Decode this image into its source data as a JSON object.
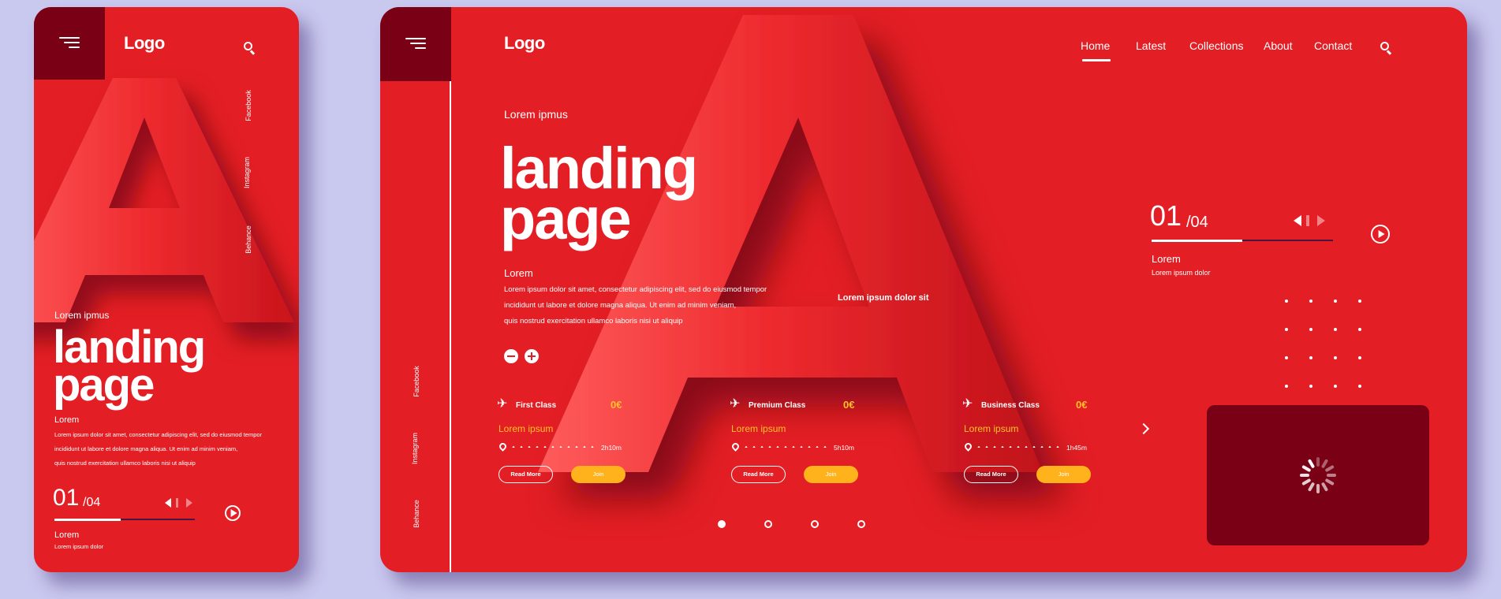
{
  "mobile": {
    "logo": "Logo",
    "social": [
      "Facebook",
      "Instagram",
      "Behance"
    ],
    "hero_eyebrow": "Lorem  ipmus",
    "hero_line1": "landing",
    "hero_line2": "page",
    "body_title": "Lorem",
    "body_lines": [
      "Lorem ipsum dolor sit amet, consectetur adipiscing elit, sed do eiusmod tempor",
      "incididunt ut labore et dolore magna aliqua. Ut enim ad minim veniam,",
      "quis nostrud exercitation ullamco laboris nisi ut aliquip"
    ],
    "counter_current": "01",
    "counter_total": "/04",
    "progress": 0.47,
    "slide_title": "Lorem",
    "slide_sub": "Lorem ipsum dolor"
  },
  "desktop": {
    "logo": "Logo",
    "nav": [
      "Home",
      "Latest",
      "Collections",
      "About",
      "Contact"
    ],
    "active_nav": "Home",
    "social": [
      "Facebook",
      "Instagram",
      "Behance"
    ],
    "hero_eyebrow": "Lorem  ipmus",
    "hero_line1": "landing",
    "hero_line2": "page",
    "body_title": "Lorem",
    "body_lines": [
      "Lorem ipsum dolor sit amet, consectetur adipiscing elit, sed do eiusmod tempor",
      "incididunt ut labore et dolore magna aliqua. Ut enim ad minim veniam,",
      "quis nostrud exercitation ullamco laboris nisi ut aliquip"
    ],
    "letter_caption": "Lorem ipsum dolor sit",
    "counter_current": "01",
    "counter_total": "/04",
    "progress": 0.5,
    "slide_title": "Lorem",
    "slide_sub": "Lorem ipsum dolor",
    "cards": [
      {
        "title": "First Class",
        "price": "0€",
        "subtitle": "Lorem ipsum",
        "duration": "2h10m",
        "read_more": "Read More",
        "join": "Join"
      },
      {
        "title": "Premium Class",
        "price": "0€",
        "subtitle": "Lorem ipsum",
        "duration": "5h10m",
        "read_more": "Read More",
        "join": "Join"
      },
      {
        "title": "Business Class",
        "price": "0€",
        "subtitle": "Lorem ipsum",
        "duration": "1h45m",
        "read_more": "Read More",
        "join": "Join"
      }
    ],
    "pagination_count": 4,
    "pagination_active": 1
  },
  "colors": {
    "background": "#c9c8ef",
    "primary_red": "#e31e24",
    "dark_red": "#7a0016",
    "accent_yellow": "#ffc229",
    "join_button": "#ffb21c"
  },
  "icons": {
    "menu": "hamburger-menu-icon",
    "search": "search-icon",
    "play": "play-icon",
    "plane": "airplane-icon",
    "pin": "location-pin-icon",
    "next": "chevron-right-icon",
    "loading": "spinner-icon"
  }
}
